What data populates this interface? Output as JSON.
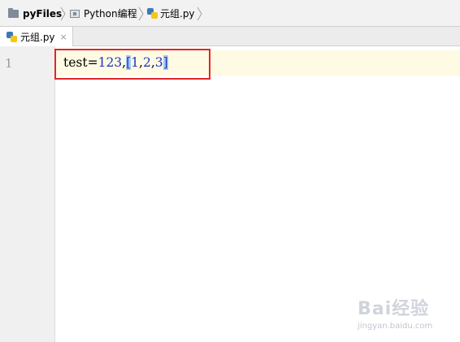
{
  "breadcrumb": {
    "project": "pyFiles",
    "folder": "Python编程",
    "file": "元组.py"
  },
  "tabs": [
    {
      "label": "元组.py",
      "close": "×"
    }
  ],
  "gutter": {
    "line_number": "1"
  },
  "code": {
    "prefix": "test=",
    "number": "123",
    "comma1": ",",
    "open_bracket": "[",
    "el1": "1",
    "comma2": ",",
    "el2": "2",
    "comma3": ",",
    "el3": "3",
    "close_bracket": "]"
  },
  "watermark": {
    "text": "Bai经验",
    "sub": "jingyan.baidu.com"
  },
  "colors": {
    "number": "#1c34c2",
    "bracket_match_bg": "#a9c8f5",
    "caret_line_bg": "#fffae3",
    "annotation_box": "#e0262a"
  }
}
